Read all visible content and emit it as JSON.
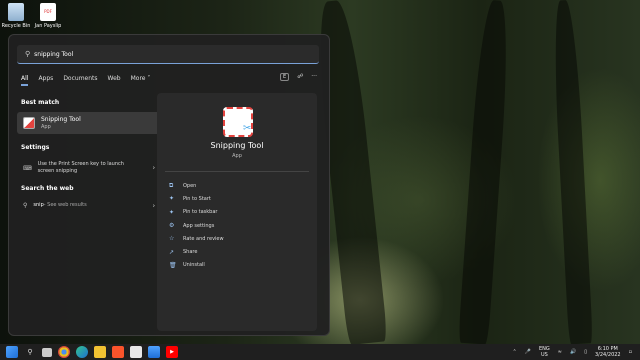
{
  "desktop": {
    "icons": [
      {
        "label": "Recycle Bin",
        "icon": "recycle-bin-icon"
      },
      {
        "label": "Jan Payslip",
        "icon": "pdf-file-icon",
        "badge": "PDF"
      }
    ]
  },
  "search": {
    "value": "snipping Tool"
  },
  "tabs": [
    {
      "label": "All",
      "active": true
    },
    {
      "label": "Apps"
    },
    {
      "label": "Documents"
    },
    {
      "label": "Web"
    },
    {
      "label": "More ˅"
    }
  ],
  "tab_tools": {
    "badge": "E",
    "share_icon": "share-icon",
    "more": "···"
  },
  "best_match": {
    "title": "Best match",
    "app_name": "Snipping Tool",
    "app_type": "App"
  },
  "settings": {
    "title": "Settings",
    "item": "Use the Print Screen key to launch screen snipping"
  },
  "web": {
    "title": "Search the web",
    "query": "snip",
    "suffix": " - See web results"
  },
  "preview": {
    "app_name": "Snipping Tool",
    "app_type": "App",
    "actions": [
      {
        "label": "Open",
        "icon": "open-icon"
      },
      {
        "label": "Pin to Start",
        "icon": "pin-icon"
      },
      {
        "label": "Pin to taskbar",
        "icon": "pin-icon"
      },
      {
        "label": "App settings",
        "icon": "gear-icon"
      },
      {
        "label": "Rate and review",
        "icon": "star-icon"
      },
      {
        "label": "Share",
        "icon": "share-icon"
      },
      {
        "label": "Uninstall",
        "icon": "trash-icon"
      }
    ]
  },
  "taskbar": {
    "lang_1": "ENG",
    "lang_2": "US",
    "time": "6:10 PM",
    "date": "3/24/2022"
  },
  "colors": {
    "accent": "#7aa2d8",
    "panel": "#202020"
  }
}
